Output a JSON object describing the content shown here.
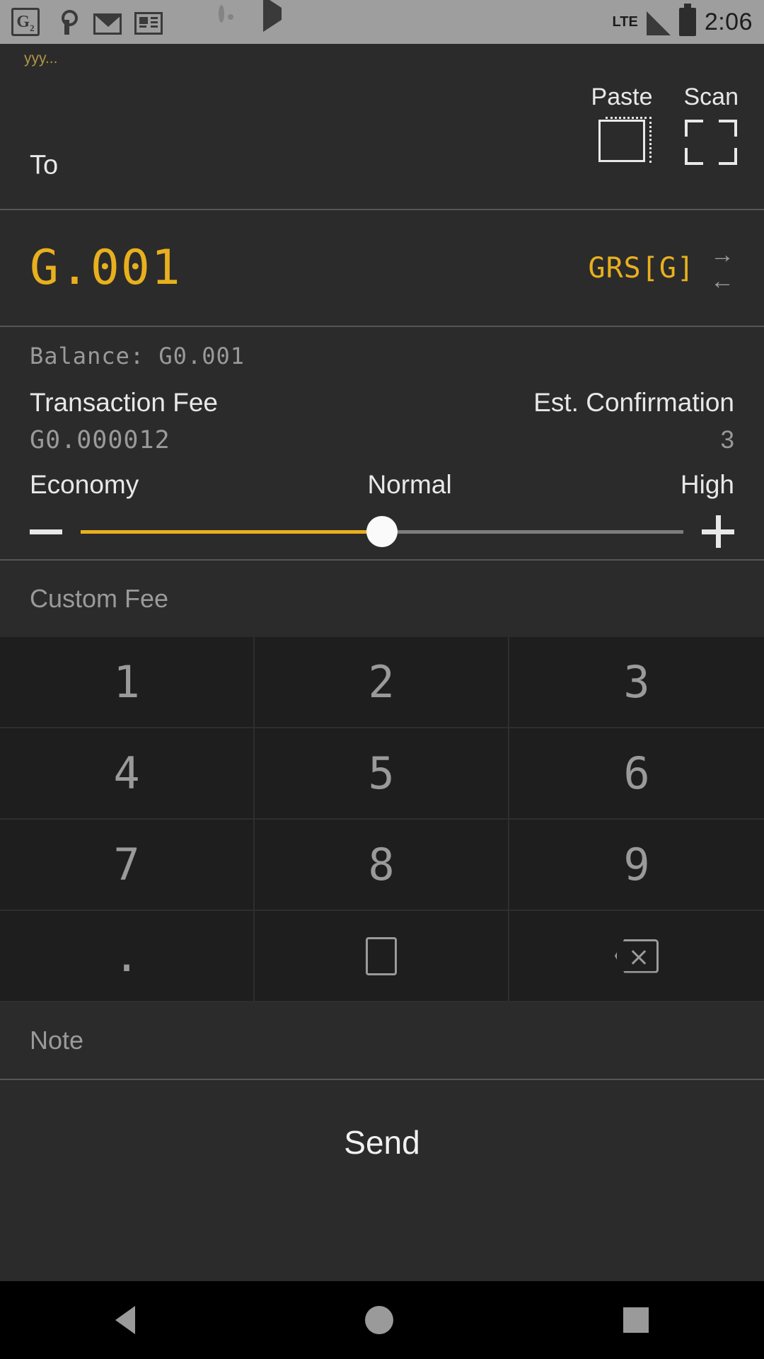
{
  "statusbar": {
    "icons": [
      "g2-app-icon",
      "key-icon",
      "gmail-icon",
      "news-icon",
      "sd-card-icon",
      "disc-icon",
      "play-store-icon"
    ],
    "network": "LTE",
    "time": "2:06"
  },
  "send_form": {
    "to": {
      "hint": "yyy...",
      "label": "To",
      "paste_label": "Paste",
      "scan_label": "Scan"
    },
    "amount": {
      "value": "G.001",
      "currency": "GRS[G]",
      "swap_icon": "swap-arrows-icon"
    },
    "balance": "Balance: G0.001",
    "fee": {
      "fee_label": "Transaction Fee",
      "fee_value": "G0.000012",
      "confirm_label": "Est. Confirmation",
      "confirm_value": "3",
      "speed_low": "Economy",
      "speed_mid": "Normal",
      "speed_high": "High",
      "slider_percent": 50,
      "minus_label": "decrease-fee",
      "plus_label": "increase-fee"
    },
    "custom_fee_placeholder": "Custom Fee",
    "keypad": [
      "1",
      "2",
      "3",
      "4",
      "5",
      "6",
      "7",
      "8",
      "9",
      ".",
      "blank-key",
      "backspace-key"
    ],
    "note_placeholder": "Note",
    "send_label": "Send"
  },
  "navbar": {
    "back": "back-button",
    "home": "home-button",
    "recents": "recents-button"
  },
  "colors": {
    "accent": "#e8b01e",
    "background": "#2b2b2b",
    "keypad_bg": "#1e1e1e",
    "text": "#e8e8e8",
    "muted": "#9a9a9a",
    "statusbar": "#9e9e9e"
  }
}
